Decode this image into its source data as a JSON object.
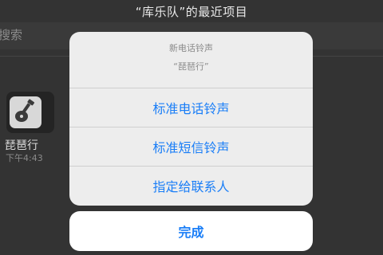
{
  "background": {
    "title": "“库乐队”的最近项目",
    "search_placeholder": "搜索",
    "file": {
      "name": "琵琶行",
      "time": "下午4:43",
      "icon": "guitar-icon"
    }
  },
  "action_sheet": {
    "title": "新电话铃声",
    "message": "“琵琶行”",
    "actions": [
      {
        "label": "标准电话铃声"
      },
      {
        "label": "标准短信铃声"
      },
      {
        "label": "指定给联系人"
      }
    ],
    "done_label": "完成",
    "accent": "#1a7ef7"
  }
}
